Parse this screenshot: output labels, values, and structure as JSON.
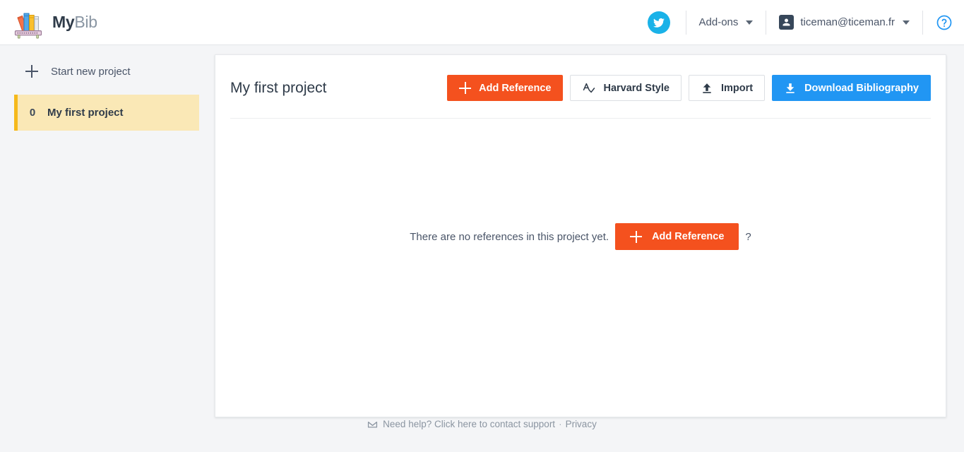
{
  "header": {
    "brand_bold": "My",
    "brand_light": "Bib",
    "logo_icon": "bookshelf-logo-icon",
    "twitter_icon": "twitter-icon",
    "addons_label": "Add-ons",
    "account_icon": "account-avatar-icon",
    "account_email": "ticeman@ticeman.fr",
    "help_icon": "help-circle-icon"
  },
  "sidebar": {
    "new_project_label": "Start new project",
    "new_project_icon": "plus-icon",
    "projects": [
      {
        "count": "0",
        "name": "My first project",
        "active": true
      }
    ]
  },
  "main": {
    "project_title": "My first project",
    "toolbar": {
      "add_reference_label": "Add Reference",
      "add_reference_icon": "plus-icon",
      "style_label": "Harvard Style",
      "style_icon": "spellcheck-icon",
      "import_label": "Import",
      "import_icon": "upload-icon",
      "download_label": "Download Bibliography",
      "download_icon": "download-icon"
    },
    "empty_state": {
      "message": "There are no references in this project yet.",
      "button_label": "Add Reference",
      "button_icon": "plus-icon",
      "trailing_text": "?"
    }
  },
  "footer": {
    "mail_icon": "envelope-icon",
    "support_text": "Need help? Click here to contact support",
    "separator": "·",
    "privacy_label": "Privacy"
  },
  "colors": {
    "accent_orange": "#f4511e",
    "accent_blue": "#2196f3",
    "twitter_blue": "#1ab2e8",
    "active_project_bg": "#fae8b6",
    "active_project_border": "#f5b91c",
    "page_bg": "#f4f5f7"
  }
}
